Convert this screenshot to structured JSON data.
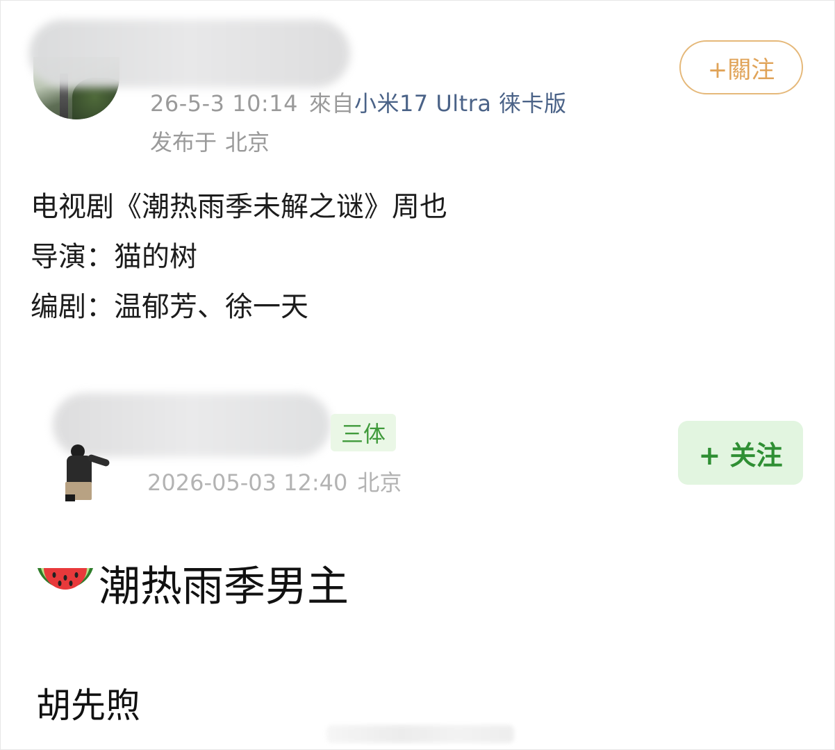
{
  "posts": [
    {
      "follow_label": "+關注",
      "timestamp": "26-5-3 10:14",
      "via_label": "來自",
      "device": "小米17 Ultra 徕卡版",
      "location_prefix": "发布于",
      "location": "北京",
      "lines": [
        "电视剧《潮热雨季未解之谜》周也",
        "导演：猫的树",
        "编剧：温郁芳、徐一天"
      ]
    },
    {
      "badge": "三体",
      "follow_label": "+ 关注",
      "timestamp": "2026-05-03 12:40",
      "location": "北京",
      "title_emoji": "watermelon-icon",
      "title": "潮热雨季男主",
      "name": "胡先煦"
    }
  ],
  "colors": {
    "follow1_border": "#e5b879",
    "follow1_text": "#e0a358",
    "device_text": "#4a6287",
    "follow2_bg": "#e2f5e0",
    "follow2_text": "#2f8f34",
    "badge_bg": "#eaf7e6",
    "badge_text": "#3f9a3a"
  }
}
